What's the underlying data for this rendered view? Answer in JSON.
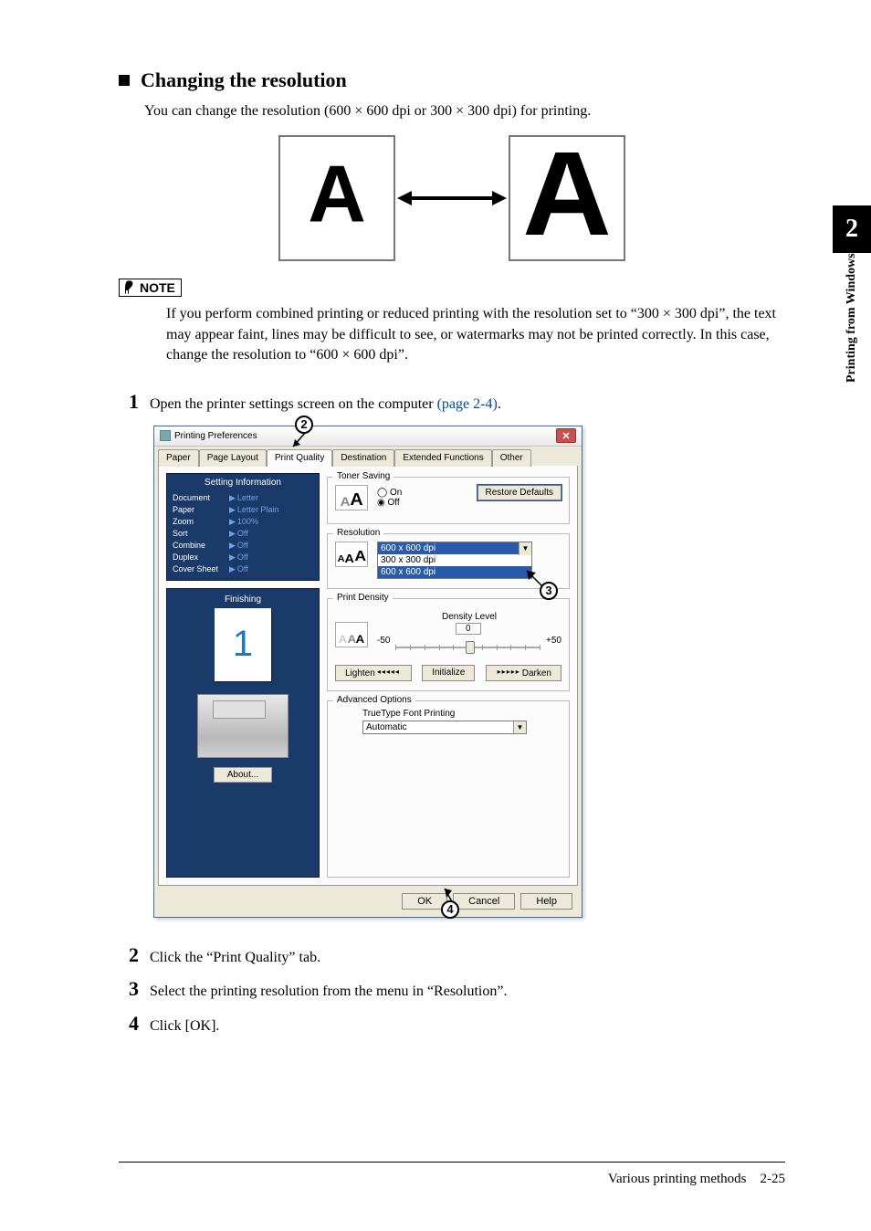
{
  "side_tab": {
    "chapter": "2",
    "label": "Printing from Windows"
  },
  "heading": "Changing the resolution",
  "intro": "You can change the resolution (600 × 600 dpi or 300 × 300 dpi) for printing.",
  "note": {
    "label": "NOTE",
    "text": "If you perform combined printing or reduced printing with the resolution set to “300 × 300 dpi”, the text may appear faint, lines may be difficult to see, or watermarks may not be printed correctly.  In this case, change the resolution to “600 × 600 dpi”."
  },
  "steps": {
    "s1_text": "Open the printer settings screen on the computer ",
    "s1_link": "(page 2-4)",
    "s1_suffix": ".",
    "s2": "Click the “Print Quality” tab.",
    "s3": "Select the printing resolution from the menu in “Resolution”.",
    "s4": "Click [OK]."
  },
  "dialog": {
    "title": "Printing Preferences",
    "close_glyph": "✕",
    "tabs": [
      "Paper",
      "Page Layout",
      "Print Quality",
      "Destination",
      "Extended Functions",
      "Other"
    ],
    "active_tab_index": 2,
    "info_header": "Setting Information",
    "info_rows": [
      {
        "k": "Document",
        "v": "Letter"
      },
      {
        "k": "Paper",
        "v": "Letter Plain"
      },
      {
        "k": "Zoom",
        "v": "100%"
      },
      {
        "k": "Sort",
        "v": "Off"
      },
      {
        "k": "Combine",
        "v": "Off"
      },
      {
        "k": "Duplex",
        "v": "Off"
      },
      {
        "k": "Cover Sheet",
        "v": "Off"
      }
    ],
    "finishing_label": "Finishing",
    "page_preview_number": "1",
    "about_label": "About...",
    "restore_label": "Restore Defaults",
    "toner_saving": {
      "legend": "Toner Saving",
      "on": "On",
      "off": "Off",
      "selected": "off"
    },
    "resolution": {
      "legend": "Resolution",
      "options": [
        "600 x 600 dpi",
        "300 x 300 dpi",
        "600 x 600 dpi"
      ],
      "selected_index": 0
    },
    "density": {
      "legend": "Print Density",
      "label": "Density Level",
      "value_display": "0",
      "left": "-50",
      "right": "+50",
      "lighten": "Lighten",
      "initialize": "Initialize",
      "darken": "Darken"
    },
    "advanced": {
      "legend": "Advanced Options",
      "field_label": "TrueType Font Printing",
      "value": "Automatic"
    },
    "footer": {
      "ok": "OK",
      "cancel": "Cancel",
      "help": "Help"
    }
  },
  "footer": {
    "text": "Various printing methods",
    "page": "2-25"
  }
}
